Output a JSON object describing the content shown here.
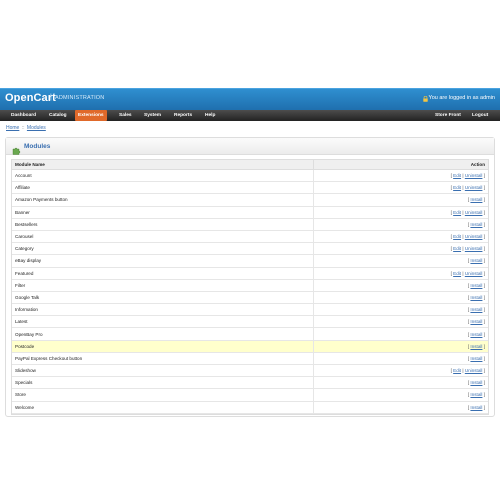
{
  "header": {
    "logo": "OpenCart",
    "separator": "|",
    "subtitle": "ADMINISTRATION",
    "login_text": "You are logged in as admin"
  },
  "nav": {
    "items": [
      {
        "label": "Dashboard",
        "active": false
      },
      {
        "label": "Catalog",
        "active": false
      },
      {
        "label": "Extensions",
        "active": true
      },
      {
        "label": "Sales",
        "active": false
      },
      {
        "label": "System",
        "active": false
      },
      {
        "label": "Reports",
        "active": false
      },
      {
        "label": "Help",
        "active": false
      }
    ],
    "store_front": "Store Front",
    "logout": "Logout"
  },
  "breadcrumb": {
    "home": "Home",
    "separator": "::",
    "current": "Modules"
  },
  "panel": {
    "title": "Modules",
    "columns": {
      "name": "Module Name",
      "action": "Action"
    },
    "rows": [
      {
        "name": "Account",
        "actions": [
          "Edit",
          "Uninstall"
        ]
      },
      {
        "name": "Affiliate",
        "actions": [
          "Edit",
          "Uninstall"
        ]
      },
      {
        "name": "Amazon Payments button",
        "actions": [
          "Install"
        ]
      },
      {
        "name": "Banner",
        "actions": [
          "Edit",
          "Uninstall"
        ]
      },
      {
        "name": "Bestsellers",
        "actions": [
          "Install"
        ]
      },
      {
        "name": "Carousel",
        "actions": [
          "Edit",
          "Uninstall"
        ]
      },
      {
        "name": "Category",
        "actions": [
          "Edit",
          "Uninstall"
        ]
      },
      {
        "name": "eBay display",
        "actions": [
          "Install"
        ]
      },
      {
        "name": "Featured",
        "actions": [
          "Edit",
          "Uninstall"
        ]
      },
      {
        "name": "Filter",
        "actions": [
          "Install"
        ]
      },
      {
        "name": "Google Talk",
        "actions": [
          "Install"
        ]
      },
      {
        "name": "Information",
        "actions": [
          "Install"
        ]
      },
      {
        "name": "Latest",
        "actions": [
          "Install"
        ]
      },
      {
        "name": "OpenBay Pro",
        "actions": [
          "Install"
        ]
      },
      {
        "name": "Postcode",
        "actions": [
          "Install"
        ],
        "highlight": true
      },
      {
        "name": "PayPal Express Checkout button",
        "actions": [
          "Install"
        ]
      },
      {
        "name": "Slideshow",
        "actions": [
          "Edit",
          "Uninstall"
        ]
      },
      {
        "name": "Specials",
        "actions": [
          "Install"
        ]
      },
      {
        "name": "Store",
        "actions": [
          "Install"
        ]
      },
      {
        "name": "Welcome",
        "actions": [
          "Install"
        ]
      }
    ]
  },
  "colors": {
    "header_blue": "#1f6fae",
    "nav_dark": "#333333",
    "nav_active": "#e0692a",
    "link_blue": "#3a6fb0",
    "highlight_row": "#ffffcc"
  }
}
